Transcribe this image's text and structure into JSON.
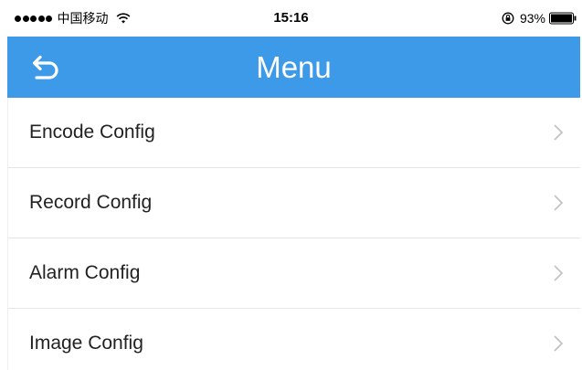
{
  "status_bar": {
    "carrier": "中国移动",
    "time": "15:16",
    "battery": "93%",
    "icons": [
      "signal-dots-icon",
      "wifi-icon",
      "orientation-lock-icon",
      "battery-icon"
    ]
  },
  "navbar": {
    "title": "Menu",
    "back_icon": "back-arrow-icon",
    "color": "#3d9ae8"
  },
  "menu": {
    "items": [
      {
        "label": "Encode Config"
      },
      {
        "label": "Record Config"
      },
      {
        "label": "Alarm Config"
      },
      {
        "label": "Image Config"
      }
    ],
    "chevron_icon": "chevron-right-icon"
  }
}
